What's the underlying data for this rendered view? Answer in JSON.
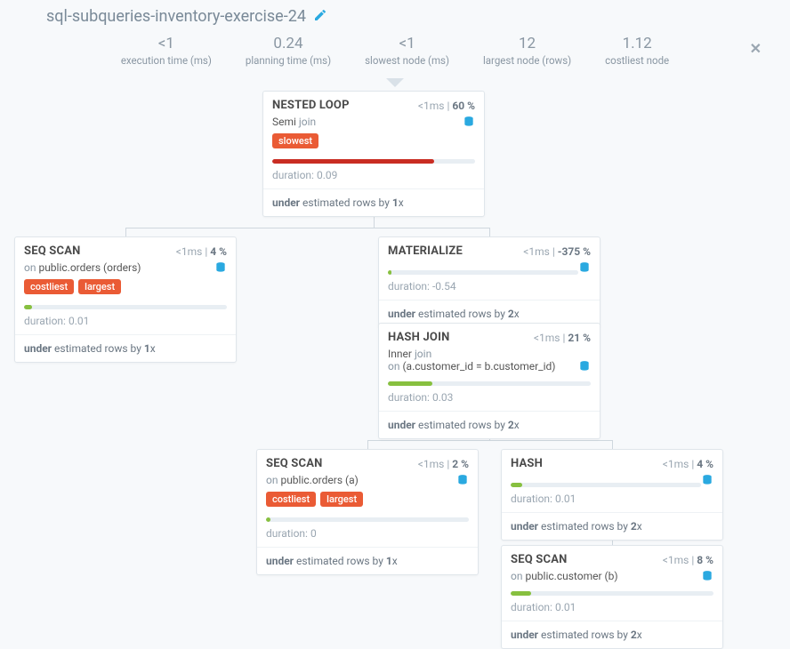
{
  "title": "sql-subqueries-inventory-exercise-24",
  "metrics": {
    "exec_time": {
      "value": "<1",
      "label": "execution time (ms)"
    },
    "plan_time": {
      "value": "0.24",
      "label": "planning time (ms)"
    },
    "slowest": {
      "value": "<1",
      "label": "slowest node (ms)"
    },
    "largest": {
      "value": "12",
      "label": "largest node (rows)"
    },
    "costliest": {
      "value": "1.12",
      "label": "costliest node"
    }
  },
  "labels": {
    "duration_prefix": "duration: ",
    "under_prefix": "under",
    "estimated_middle": " estimated rows by ",
    "times_suffix": "x",
    "on_prefix": "on "
  },
  "nodes": {
    "nested_loop": {
      "title": "NESTED LOOP",
      "time": "<1ms",
      "pct": "60 %",
      "sub1": "Semi ",
      "sub1_light": "join",
      "badges": [
        "slowest"
      ],
      "bar_class": "bar-red",
      "bar_width": "80%",
      "duration": "0.09",
      "estimate_mult": "1"
    },
    "seq_orders_top": {
      "title": "SEQ SCAN",
      "time": "<1ms",
      "pct": "4 %",
      "sub_on": "public.orders (orders)",
      "badges": [
        "costliest",
        "largest"
      ],
      "bar_class": "bar-green",
      "bar_width": "4%",
      "duration": "0.01",
      "estimate_mult": "1"
    },
    "materialize": {
      "title": "MATERIALIZE",
      "time": "<1ms",
      "pct": "-375 %",
      "bar_class": "bar-green",
      "bar_width": "2%",
      "duration": "-0.54",
      "estimate_mult": "2"
    },
    "hash_join": {
      "title": "HASH JOIN",
      "time": "<1ms",
      "pct": "21 %",
      "sub1": "Inner ",
      "sub1_light": "join",
      "sub2_light": "on ",
      "sub2": "(a.customer_id = b.customer_id)",
      "bar_class": "bar-green",
      "bar_width": "22%",
      "duration": "0.03",
      "estimate_mult": "2"
    },
    "seq_orders_a": {
      "title": "SEQ SCAN",
      "time": "<1ms",
      "pct": "2 %",
      "sub_on": "public.orders (a)",
      "badges": [
        "costliest",
        "largest"
      ],
      "bar_class": "bar-green",
      "bar_width": "2%",
      "duration": "0",
      "estimate_mult": "1"
    },
    "hash": {
      "title": "HASH",
      "time": "<1ms",
      "pct": "4 %",
      "bar_class": "bar-green",
      "bar_width": "6%",
      "duration": "0.01",
      "estimate_mult": "2"
    },
    "seq_customer": {
      "title": "SEQ SCAN",
      "time": "<1ms",
      "pct": "8 %",
      "sub_on": "public.customer (b)",
      "bar_class": "bar-green",
      "bar_width": "10%",
      "duration": "0.01",
      "estimate_mult": "2"
    }
  }
}
